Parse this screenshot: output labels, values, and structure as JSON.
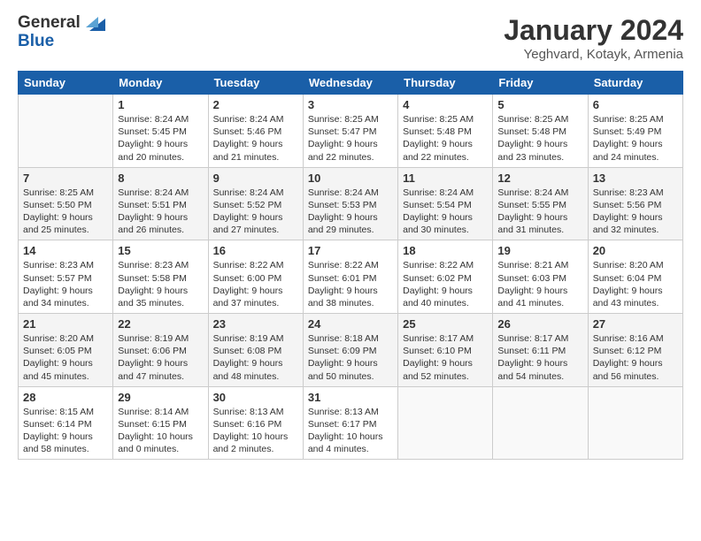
{
  "header": {
    "logo_line1": "General",
    "logo_line2": "Blue",
    "month_title": "January 2024",
    "location": "Yeghvard, Kotayk, Armenia"
  },
  "days_of_week": [
    "Sunday",
    "Monday",
    "Tuesday",
    "Wednesday",
    "Thursday",
    "Friday",
    "Saturday"
  ],
  "weeks": [
    [
      {
        "day": "",
        "content": ""
      },
      {
        "day": "1",
        "content": "Sunrise: 8:24 AM\nSunset: 5:45 PM\nDaylight: 9 hours\nand 20 minutes."
      },
      {
        "day": "2",
        "content": "Sunrise: 8:24 AM\nSunset: 5:46 PM\nDaylight: 9 hours\nand 21 minutes."
      },
      {
        "day": "3",
        "content": "Sunrise: 8:25 AM\nSunset: 5:47 PM\nDaylight: 9 hours\nand 22 minutes."
      },
      {
        "day": "4",
        "content": "Sunrise: 8:25 AM\nSunset: 5:48 PM\nDaylight: 9 hours\nand 22 minutes."
      },
      {
        "day": "5",
        "content": "Sunrise: 8:25 AM\nSunset: 5:48 PM\nDaylight: 9 hours\nand 23 minutes."
      },
      {
        "day": "6",
        "content": "Sunrise: 8:25 AM\nSunset: 5:49 PM\nDaylight: 9 hours\nand 24 minutes."
      }
    ],
    [
      {
        "day": "7",
        "content": "Sunrise: 8:25 AM\nSunset: 5:50 PM\nDaylight: 9 hours\nand 25 minutes."
      },
      {
        "day": "8",
        "content": "Sunrise: 8:24 AM\nSunset: 5:51 PM\nDaylight: 9 hours\nand 26 minutes."
      },
      {
        "day": "9",
        "content": "Sunrise: 8:24 AM\nSunset: 5:52 PM\nDaylight: 9 hours\nand 27 minutes."
      },
      {
        "day": "10",
        "content": "Sunrise: 8:24 AM\nSunset: 5:53 PM\nDaylight: 9 hours\nand 29 minutes."
      },
      {
        "day": "11",
        "content": "Sunrise: 8:24 AM\nSunset: 5:54 PM\nDaylight: 9 hours\nand 30 minutes."
      },
      {
        "day": "12",
        "content": "Sunrise: 8:24 AM\nSunset: 5:55 PM\nDaylight: 9 hours\nand 31 minutes."
      },
      {
        "day": "13",
        "content": "Sunrise: 8:23 AM\nSunset: 5:56 PM\nDaylight: 9 hours\nand 32 minutes."
      }
    ],
    [
      {
        "day": "14",
        "content": "Sunrise: 8:23 AM\nSunset: 5:57 PM\nDaylight: 9 hours\nand 34 minutes."
      },
      {
        "day": "15",
        "content": "Sunrise: 8:23 AM\nSunset: 5:58 PM\nDaylight: 9 hours\nand 35 minutes."
      },
      {
        "day": "16",
        "content": "Sunrise: 8:22 AM\nSunset: 6:00 PM\nDaylight: 9 hours\nand 37 minutes."
      },
      {
        "day": "17",
        "content": "Sunrise: 8:22 AM\nSunset: 6:01 PM\nDaylight: 9 hours\nand 38 minutes."
      },
      {
        "day": "18",
        "content": "Sunrise: 8:22 AM\nSunset: 6:02 PM\nDaylight: 9 hours\nand 40 minutes."
      },
      {
        "day": "19",
        "content": "Sunrise: 8:21 AM\nSunset: 6:03 PM\nDaylight: 9 hours\nand 41 minutes."
      },
      {
        "day": "20",
        "content": "Sunrise: 8:20 AM\nSunset: 6:04 PM\nDaylight: 9 hours\nand 43 minutes."
      }
    ],
    [
      {
        "day": "21",
        "content": "Sunrise: 8:20 AM\nSunset: 6:05 PM\nDaylight: 9 hours\nand 45 minutes."
      },
      {
        "day": "22",
        "content": "Sunrise: 8:19 AM\nSunset: 6:06 PM\nDaylight: 9 hours\nand 47 minutes."
      },
      {
        "day": "23",
        "content": "Sunrise: 8:19 AM\nSunset: 6:08 PM\nDaylight: 9 hours\nand 48 minutes."
      },
      {
        "day": "24",
        "content": "Sunrise: 8:18 AM\nSunset: 6:09 PM\nDaylight: 9 hours\nand 50 minutes."
      },
      {
        "day": "25",
        "content": "Sunrise: 8:17 AM\nSunset: 6:10 PM\nDaylight: 9 hours\nand 52 minutes."
      },
      {
        "day": "26",
        "content": "Sunrise: 8:17 AM\nSunset: 6:11 PM\nDaylight: 9 hours\nand 54 minutes."
      },
      {
        "day": "27",
        "content": "Sunrise: 8:16 AM\nSunset: 6:12 PM\nDaylight: 9 hours\nand 56 minutes."
      }
    ],
    [
      {
        "day": "28",
        "content": "Sunrise: 8:15 AM\nSunset: 6:14 PM\nDaylight: 9 hours\nand 58 minutes."
      },
      {
        "day": "29",
        "content": "Sunrise: 8:14 AM\nSunset: 6:15 PM\nDaylight: 10 hours\nand 0 minutes."
      },
      {
        "day": "30",
        "content": "Sunrise: 8:13 AM\nSunset: 6:16 PM\nDaylight: 10 hours\nand 2 minutes."
      },
      {
        "day": "31",
        "content": "Sunrise: 8:13 AM\nSunset: 6:17 PM\nDaylight: 10 hours\nand 4 minutes."
      },
      {
        "day": "",
        "content": ""
      },
      {
        "day": "",
        "content": ""
      },
      {
        "day": "",
        "content": ""
      }
    ]
  ]
}
